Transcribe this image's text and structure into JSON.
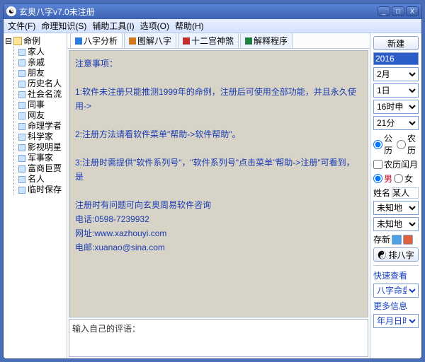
{
  "window": {
    "title": "玄奥八字v7.0未注册"
  },
  "controls": {
    "min": "_",
    "max": "□",
    "close": "X"
  },
  "menu": [
    "文件(F)",
    "命理知识(S)",
    "辅助工具(I)",
    "选项(O)",
    "帮助(H)"
  ],
  "tree": {
    "root": "命例",
    "items": [
      "家人",
      "亲戚",
      "朋友",
      "历史名人",
      "社会名流",
      "同事",
      "网友",
      "命理学者",
      "科学家",
      "影视明星",
      "军事家",
      "富商巨贾",
      "名人",
      "临时保存"
    ]
  },
  "tabs": [
    {
      "label": "八字分析",
      "color": "#2a7de0"
    },
    {
      "label": "图解八字",
      "color": "#d07a20"
    },
    {
      "label": "十二宫神煞",
      "color": "#c03030"
    },
    {
      "label": "解释程序",
      "color": "#208040"
    }
  ],
  "notice": {
    "heading": "注意事项：",
    "lines": [
      "1:软件未注册只能推测1999年的命例，注册后可使用全部功能，并且永久使用->",
      "2:注册方法请看软件菜单\"帮助->软件帮助\"。",
      "3:注册时需提供\"软件系列号\"，\"软件系列号\"点击菜单\"帮助->注册\"可看到，是"
    ],
    "contact": [
      "注册时有问题可向玄奥周易软件咨询",
      "电话:0598-7239932",
      "网址:www.xazhouyi.com",
      "电邮:xuanao@sina.com"
    ]
  },
  "comment_placeholder": "输入自己的评语：",
  "right": {
    "new_btn": "新建",
    "year": "2016",
    "month": "2月",
    "day": "1日",
    "hour": "16时申",
    "minute": "21分",
    "cal1": "公历",
    "cal2": "农历",
    "leap": "农历闰月",
    "sex1": "男",
    "sex2": "女",
    "name_label": "姓名",
    "name_value": "某人",
    "place1": "未知地",
    "place2": "未知地",
    "save_label": "存新",
    "chart_btn": "排八字",
    "quick_label": "快速查看",
    "quick_sel": "八字命盘",
    "more_label": "更多信息",
    "more_sel": "年月日时断定"
  }
}
